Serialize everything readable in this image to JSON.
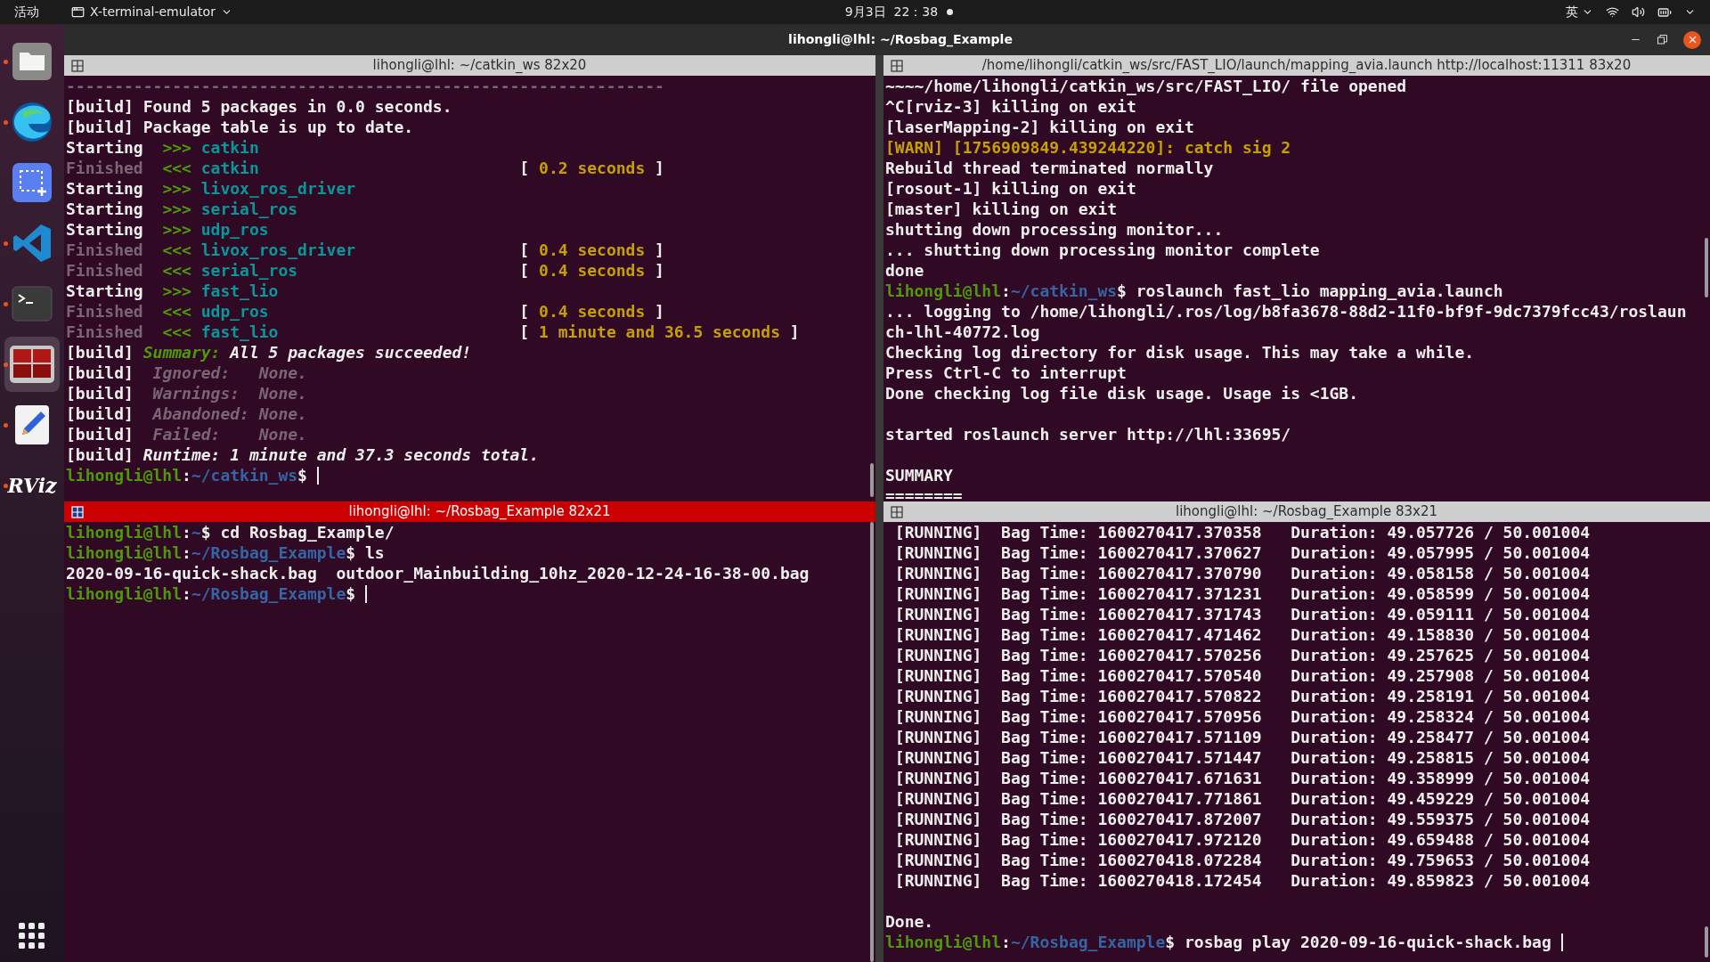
{
  "top_bar": {
    "activities": "活动",
    "app_menu": "X-terminal-emulator",
    "clock": "9月3日  22：38",
    "input_method": "英"
  },
  "window": {
    "title": "lihongli@lhl: ~/Rosbag_Example"
  },
  "dock": [
    {
      "kind": "files",
      "running": true,
      "selected": false
    },
    {
      "kind": "browser",
      "running": true,
      "selected": false
    },
    {
      "kind": "screenshot",
      "running": false,
      "selected": false
    },
    {
      "kind": "code",
      "running": true,
      "selected": false
    },
    {
      "kind": "terminal",
      "running": true,
      "selected": false
    },
    {
      "kind": "terminator",
      "running": true,
      "selected": true
    },
    {
      "kind": "editor",
      "running": true,
      "selected": false
    },
    {
      "kind": "rviz",
      "running": true,
      "selected": false,
      "label": "RViz"
    }
  ],
  "panes": [
    {
      "title": "lihongli@lhl: ~/catkin_ws 82x20",
      "focused": false,
      "cursor": true,
      "lines": [
        {
          "kind": "text",
          "parts": [
            {
              "kind": "dim",
              "text": "--------------------------------------------------------------"
            }
          ]
        },
        {
          "kind": "text",
          "parts": [
            {
              "kind": "plain",
              "text": "[build] Found 5 packages in 0.0 seconds."
            }
          ]
        },
        {
          "kind": "text",
          "parts": [
            {
              "kind": "plain",
              "text": "[build] Package table is up to date."
            }
          ]
        },
        {
          "kind": "text",
          "parts": [
            {
              "kind": "plain",
              "text": "Starting  "
            },
            {
              "kind": "arrow",
              "text": ">>> "
            },
            {
              "kind": "package",
              "text": "catkin"
            }
          ]
        },
        {
          "kind": "text",
          "parts": [
            {
              "kind": "dim",
              "text": "Finished"
            },
            {
              "kind": "arrow",
              "text": "  <<< "
            },
            {
              "kind": "package",
              "text": "catkin"
            },
            {
              "kind": "plain",
              "text": "                           ["
            },
            {
              "kind": "time",
              "text": " 0.2 seconds "
            },
            {
              "kind": "plain",
              "text": "]"
            }
          ]
        },
        {
          "kind": "text",
          "parts": [
            {
              "kind": "plain",
              "text": "Starting  "
            },
            {
              "kind": "arrow",
              "text": ">>> "
            },
            {
              "kind": "package",
              "text": "livox_ros_driver"
            }
          ]
        },
        {
          "kind": "text",
          "parts": [
            {
              "kind": "plain",
              "text": "Starting  "
            },
            {
              "kind": "arrow",
              "text": ">>> "
            },
            {
              "kind": "package",
              "text": "serial_ros"
            }
          ]
        },
        {
          "kind": "text",
          "parts": [
            {
              "kind": "plain",
              "text": "Starting  "
            },
            {
              "kind": "arrow",
              "text": ">>> "
            },
            {
              "kind": "package",
              "text": "udp_ros"
            }
          ]
        },
        {
          "kind": "text",
          "parts": [
            {
              "kind": "dim",
              "text": "Finished"
            },
            {
              "kind": "arrow",
              "text": "  <<< "
            },
            {
              "kind": "package",
              "text": "livox_ros_driver"
            },
            {
              "kind": "plain",
              "text": "                 ["
            },
            {
              "kind": "time",
              "text": " 0.4 seconds "
            },
            {
              "kind": "plain",
              "text": "]"
            }
          ]
        },
        {
          "kind": "text",
          "parts": [
            {
              "kind": "dim",
              "text": "Finished"
            },
            {
              "kind": "arrow",
              "text": "  <<< "
            },
            {
              "kind": "package",
              "text": "serial_ros"
            },
            {
              "kind": "plain",
              "text": "                       ["
            },
            {
              "kind": "time",
              "text": " 0.4 seconds "
            },
            {
              "kind": "plain",
              "text": "]"
            }
          ]
        },
        {
          "kind": "text",
          "parts": [
            {
              "kind": "plain",
              "text": "Starting  "
            },
            {
              "kind": "arrow",
              "text": ">>> "
            },
            {
              "kind": "package",
              "text": "fast_lio"
            }
          ]
        },
        {
          "kind": "text",
          "parts": [
            {
              "kind": "dim",
              "text": "Finished"
            },
            {
              "kind": "arrow",
              "text": "  <<< "
            },
            {
              "kind": "package",
              "text": "udp_ros"
            },
            {
              "kind": "plain",
              "text": "                          ["
            },
            {
              "kind": "time",
              "text": " 0.4 seconds "
            },
            {
              "kind": "plain",
              "text": "]"
            }
          ]
        },
        {
          "kind": "text",
          "parts": [
            {
              "kind": "dim",
              "text": "Finished"
            },
            {
              "kind": "arrow",
              "text": "  <<< "
            },
            {
              "kind": "package",
              "text": "fast_lio"
            },
            {
              "kind": "plain",
              "text": "                         ["
            },
            {
              "kind": "time",
              "text": " 1 minute and 36.5 seconds "
            },
            {
              "kind": "plain",
              "text": "]"
            }
          ]
        },
        {
          "kind": "text",
          "parts": [
            {
              "kind": "plain",
              "text": "[build] "
            },
            {
              "kind": "label_italic",
              "text": "Summary:"
            },
            {
              "kind": "italic",
              "text": " All 5 packages succeeded!"
            }
          ]
        },
        {
          "kind": "text",
          "parts": [
            {
              "kind": "plain",
              "text": "[build]  "
            },
            {
              "kind": "dim_italic",
              "text": "Ignored:   None."
            }
          ]
        },
        {
          "kind": "text",
          "parts": [
            {
              "kind": "plain",
              "text": "[build]  "
            },
            {
              "kind": "dim_italic",
              "text": "Warnings:  None."
            }
          ]
        },
        {
          "kind": "text",
          "parts": [
            {
              "kind": "plain",
              "text": "[build]  "
            },
            {
              "kind": "dim_italic",
              "text": "Abandoned: None."
            }
          ]
        },
        {
          "kind": "text",
          "parts": [
            {
              "kind": "plain",
              "text": "[build]  "
            },
            {
              "kind": "dim_italic",
              "text": "Failed:    None."
            }
          ]
        },
        {
          "kind": "text",
          "parts": [
            {
              "kind": "plain",
              "text": "[build] "
            },
            {
              "kind": "italic",
              "text": "Runtime: 1 minute and 37.3 seconds total."
            }
          ]
        },
        {
          "kind": "text",
          "parts": [
            {
              "kind": "prompt",
              "text": "lihongli@lhl"
            },
            {
              "kind": "plain",
              "text": ":"
            },
            {
              "kind": "path",
              "text": "~/catkin_ws"
            },
            {
              "kind": "plain",
              "text": "$"
            }
          ]
        }
      ]
    },
    {
      "title": "/home/lihongli/catkin_ws/src/FAST_LIO/launch/mapping_avia.launch http://localhost:11311 83x20",
      "focused": false,
      "cursor": false,
      "lines": [
        {
          "kind": "text",
          "parts": [
            {
              "kind": "plain",
              "text": "~~~~/home/lihongli/catkin_ws/src/FAST_LIO/ file opened"
            }
          ]
        },
        {
          "kind": "text",
          "parts": [
            {
              "kind": "plain",
              "text": "^C[rviz-3] killing on exit"
            }
          ]
        },
        {
          "kind": "text",
          "parts": [
            {
              "kind": "plain",
              "text": "[laserMapping-2] killing on exit"
            }
          ]
        },
        {
          "kind": "text",
          "parts": [
            {
              "kind": "time",
              "text": "[WARN] [1756909849.439244220]: catch sig 2"
            }
          ]
        },
        {
          "kind": "text",
          "parts": [
            {
              "kind": "plain",
              "text": "Rebuild thread terminated normally"
            }
          ]
        },
        {
          "kind": "text",
          "parts": [
            {
              "kind": "plain",
              "text": "[rosout-1] killing on exit"
            }
          ]
        },
        {
          "kind": "text",
          "parts": [
            {
              "kind": "plain",
              "text": "[master] killing on exit"
            }
          ]
        },
        {
          "kind": "text",
          "parts": [
            {
              "kind": "plain",
              "text": "shutting down processing monitor..."
            }
          ]
        },
        {
          "kind": "text",
          "parts": [
            {
              "kind": "plain",
              "text": "... shutting down processing monitor complete"
            }
          ]
        },
        {
          "kind": "text",
          "parts": [
            {
              "kind": "plain",
              "text": "done"
            }
          ]
        },
        {
          "kind": "text",
          "parts": [
            {
              "kind": "prompt",
              "text": "lihongli@lhl"
            },
            {
              "kind": "plain",
              "text": ":"
            },
            {
              "kind": "path",
              "text": "~/catkin_ws"
            },
            {
              "kind": "plain",
              "text": "$ roslaunch fast_lio mapping_avia.launch"
            }
          ]
        },
        {
          "kind": "text",
          "parts": [
            {
              "kind": "plain",
              "text": "... logging to /home/lihongli/.ros/log/b8fa3678-88d2-11f0-bf9f-9dc7379fcc43/roslaun"
            }
          ]
        },
        {
          "kind": "text",
          "parts": [
            {
              "kind": "plain",
              "text": "ch-lhl-40772.log"
            }
          ]
        },
        {
          "kind": "text",
          "parts": [
            {
              "kind": "plain",
              "text": "Checking log directory for disk usage. This may take a while."
            }
          ]
        },
        {
          "kind": "text",
          "parts": [
            {
              "kind": "plain",
              "text": "Press Ctrl-C to interrupt"
            }
          ]
        },
        {
          "kind": "text",
          "parts": [
            {
              "kind": "plain",
              "text": "Done checking log file disk usage. Usage is <1GB."
            }
          ]
        },
        {
          "kind": "blank"
        },
        {
          "kind": "text",
          "parts": [
            {
              "kind": "plain",
              "text": "started roslaunch server http://lhl:33695/"
            }
          ]
        },
        {
          "kind": "blank"
        },
        {
          "kind": "text",
          "parts": [
            {
              "kind": "plain",
              "text": "SUMMARY"
            }
          ]
        },
        {
          "kind": "text",
          "parts": [
            {
              "kind": "plain",
              "text": "========"
            }
          ]
        }
      ]
    },
    {
      "title": "lihongli@lhl: ~/Rosbag_Example 82x21",
      "focused": true,
      "cursor": true,
      "lines": [
        {
          "kind": "text",
          "parts": [
            {
              "kind": "prompt",
              "text": "lihongli@lhl"
            },
            {
              "kind": "plain",
              "text": ":"
            },
            {
              "kind": "path",
              "text": "~"
            },
            {
              "kind": "plain",
              "text": "$ cd Rosbag_Example/"
            }
          ]
        },
        {
          "kind": "text",
          "parts": [
            {
              "kind": "prompt",
              "text": "lihongli@lhl"
            },
            {
              "kind": "plain",
              "text": ":"
            },
            {
              "kind": "path",
              "text": "~/Rosbag_Example"
            },
            {
              "kind": "plain",
              "text": "$ ls"
            }
          ]
        },
        {
          "kind": "text",
          "parts": [
            {
              "kind": "plain",
              "text": "2020-09-16-quick-shack.bag  outdoor_Mainbuilding_10hz_2020-12-24-16-38-00.bag"
            }
          ]
        },
        {
          "kind": "text",
          "parts": [
            {
              "kind": "prompt",
              "text": "lihongli@lhl"
            },
            {
              "kind": "plain",
              "text": ":"
            },
            {
              "kind": "path",
              "text": "~/Rosbag_Example"
            },
            {
              "kind": "plain",
              "text": "$"
            }
          ]
        }
      ]
    },
    {
      "title": "lihongli@lhl: ~/Rosbag_Example 83x21",
      "focused": false,
      "cursor": true,
      "lines": [
        {
          "kind": "text",
          "parts": [
            {
              "kind": "plain",
              "text": " [RUNNING]  Bag Time: 1600270417.370358   Duration: 49.057726 / 50.001004"
            }
          ]
        },
        {
          "kind": "text",
          "parts": [
            {
              "kind": "plain",
              "text": " [RUNNING]  Bag Time: 1600270417.370627   Duration: 49.057995 / 50.001004"
            }
          ]
        },
        {
          "kind": "text",
          "parts": [
            {
              "kind": "plain",
              "text": " [RUNNING]  Bag Time: 1600270417.370790   Duration: 49.058158 / 50.001004"
            }
          ]
        },
        {
          "kind": "text",
          "parts": [
            {
              "kind": "plain",
              "text": " [RUNNING]  Bag Time: 1600270417.371231   Duration: 49.058599 / 50.001004"
            }
          ]
        },
        {
          "kind": "text",
          "parts": [
            {
              "kind": "plain",
              "text": " [RUNNING]  Bag Time: 1600270417.371743   Duration: 49.059111 / 50.001004"
            }
          ]
        },
        {
          "kind": "text",
          "parts": [
            {
              "kind": "plain",
              "text": " [RUNNING]  Bag Time: 1600270417.471462   Duration: 49.158830 / 50.001004"
            }
          ]
        },
        {
          "kind": "text",
          "parts": [
            {
              "kind": "plain",
              "text": " [RUNNING]  Bag Time: 1600270417.570256   Duration: 49.257625 / 50.001004"
            }
          ]
        },
        {
          "kind": "text",
          "parts": [
            {
              "kind": "plain",
              "text": " [RUNNING]  Bag Time: 1600270417.570540   Duration: 49.257908 / 50.001004"
            }
          ]
        },
        {
          "kind": "text",
          "parts": [
            {
              "kind": "plain",
              "text": " [RUNNING]  Bag Time: 1600270417.570822   Duration: 49.258191 / 50.001004"
            }
          ]
        },
        {
          "kind": "text",
          "parts": [
            {
              "kind": "plain",
              "text": " [RUNNING]  Bag Time: 1600270417.570956   Duration: 49.258324 / 50.001004"
            }
          ]
        },
        {
          "kind": "text",
          "parts": [
            {
              "kind": "plain",
              "text": " [RUNNING]  Bag Time: 1600270417.571109   Duration: 49.258477 / 50.001004"
            }
          ]
        },
        {
          "kind": "text",
          "parts": [
            {
              "kind": "plain",
              "text": " [RUNNING]  Bag Time: 1600270417.571447   Duration: 49.258815 / 50.001004"
            }
          ]
        },
        {
          "kind": "text",
          "parts": [
            {
              "kind": "plain",
              "text": " [RUNNING]  Bag Time: 1600270417.671631   Duration: 49.358999 / 50.001004"
            }
          ]
        },
        {
          "kind": "text",
          "parts": [
            {
              "kind": "plain",
              "text": " [RUNNING]  Bag Time: 1600270417.771861   Duration: 49.459229 / 50.001004"
            }
          ]
        },
        {
          "kind": "text",
          "parts": [
            {
              "kind": "plain",
              "text": " [RUNNING]  Bag Time: 1600270417.872007   Duration: 49.559375 / 50.001004"
            }
          ]
        },
        {
          "kind": "text",
          "parts": [
            {
              "kind": "plain",
              "text": " [RUNNING]  Bag Time: 1600270417.972120   Duration: 49.659488 / 50.001004"
            }
          ]
        },
        {
          "kind": "text",
          "parts": [
            {
              "kind": "plain",
              "text": " [RUNNING]  Bag Time: 1600270418.072284   Duration: 49.759653 / 50.001004"
            }
          ]
        },
        {
          "kind": "text",
          "parts": [
            {
              "kind": "plain",
              "text": " [RUNNING]  Bag Time: 1600270418.172454   Duration: 49.859823 / 50.001004"
            }
          ]
        },
        {
          "kind": "blank"
        },
        {
          "kind": "text",
          "parts": [
            {
              "kind": "plain",
              "text": "Done."
            }
          ]
        },
        {
          "kind": "text",
          "parts": [
            {
              "kind": "prompt",
              "text": "lihongli@lhl"
            },
            {
              "kind": "plain",
              "text": ":"
            },
            {
              "kind": "path",
              "text": "~/Rosbag_Example"
            },
            {
              "kind": "plain",
              "text": "$ rosbag play 2020-09-16-quick-shack.bag"
            }
          ]
        }
      ]
    }
  ]
}
